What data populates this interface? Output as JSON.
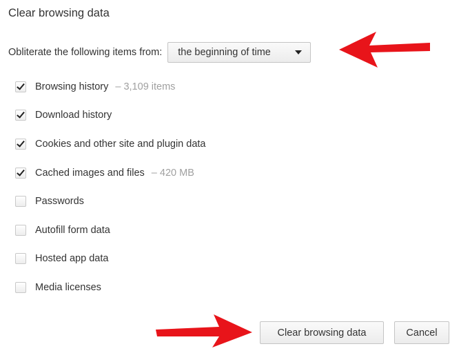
{
  "dialog": {
    "title": "Clear browsing data",
    "range_label": "Obliterate the following items from:",
    "range_value": "the beginning of time"
  },
  "items": [
    {
      "label": "Browsing history",
      "detail": "–  3,109 items",
      "checked": true
    },
    {
      "label": "Download history",
      "detail": "",
      "checked": true
    },
    {
      "label": "Cookies and other site and plugin data",
      "detail": "",
      "checked": true
    },
    {
      "label": "Cached images and files",
      "detail": "–  420 MB",
      "checked": true
    },
    {
      "label": "Passwords",
      "detail": "",
      "checked": false
    },
    {
      "label": "Autofill form data",
      "detail": "",
      "checked": false
    },
    {
      "label": "Hosted app data",
      "detail": "",
      "checked": false
    },
    {
      "label": "Media licenses",
      "detail": "",
      "checked": false
    }
  ],
  "buttons": {
    "clear_label": "Clear browsing data",
    "cancel_label": "Cancel"
  },
  "annotations": {
    "arrow_color": "#e8141a"
  }
}
